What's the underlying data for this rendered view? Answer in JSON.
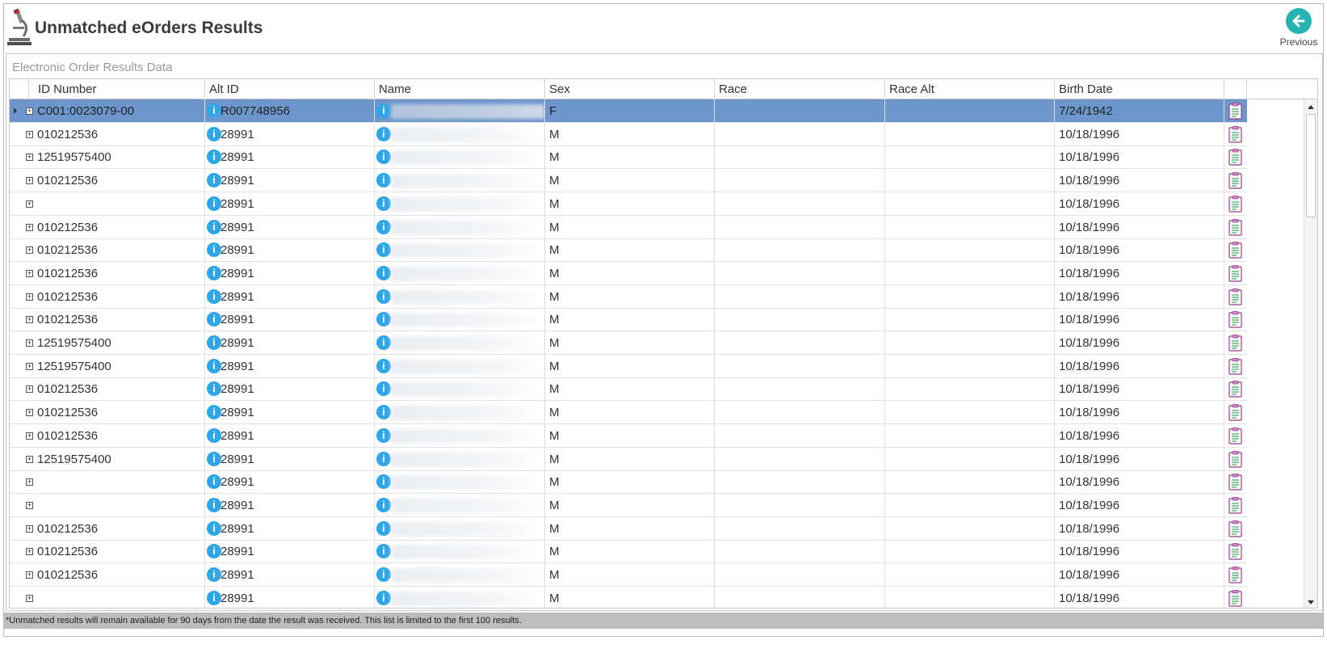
{
  "header": {
    "title": "Unmatched eOrders Results",
    "previous_label": "Previous"
  },
  "section": {
    "title": "Electronic Order Results Data"
  },
  "grid": {
    "columns": [
      "ID Number",
      "Alt ID",
      "Name",
      "Sex",
      "Race",
      "Race Alt",
      "Birth Date"
    ],
    "rows": [
      {
        "id": "C001:0023079-00",
        "alt": "R007748956",
        "sex": "F",
        "race": "",
        "race_alt": "",
        "birth": "7/24/1942",
        "selected": true
      },
      {
        "id": "010212536",
        "alt": "28991",
        "sex": "M",
        "race": "",
        "race_alt": "",
        "birth": "10/18/1996"
      },
      {
        "id": "12519575400",
        "alt": "28991",
        "sex": "M",
        "race": "",
        "race_alt": "",
        "birth": "10/18/1996"
      },
      {
        "id": "010212536",
        "alt": "28991",
        "sex": "M",
        "race": "",
        "race_alt": "",
        "birth": "10/18/1996"
      },
      {
        "id": "",
        "alt": "28991",
        "sex": "M",
        "race": "",
        "race_alt": "",
        "birth": "10/18/1996"
      },
      {
        "id": "010212536",
        "alt": "28991",
        "sex": "M",
        "race": "",
        "race_alt": "",
        "birth": "10/18/1996"
      },
      {
        "id": "010212536",
        "alt": "28991",
        "sex": "M",
        "race": "",
        "race_alt": "",
        "birth": "10/18/1996"
      },
      {
        "id": "010212536",
        "alt": "28991",
        "sex": "M",
        "race": "",
        "race_alt": "",
        "birth": "10/18/1996"
      },
      {
        "id": "010212536",
        "alt": "28991",
        "sex": "M",
        "race": "",
        "race_alt": "",
        "birth": "10/18/1996"
      },
      {
        "id": "010212536",
        "alt": "28991",
        "sex": "M",
        "race": "",
        "race_alt": "",
        "birth": "10/18/1996"
      },
      {
        "id": "12519575400",
        "alt": "28991",
        "sex": "M",
        "race": "",
        "race_alt": "",
        "birth": "10/18/1996"
      },
      {
        "id": "12519575400",
        "alt": "28991",
        "sex": "M",
        "race": "",
        "race_alt": "",
        "birth": "10/18/1996"
      },
      {
        "id": "010212536",
        "alt": "28991",
        "sex": "M",
        "race": "",
        "race_alt": "",
        "birth": "10/18/1996"
      },
      {
        "id": "010212536",
        "alt": "28991",
        "sex": "M",
        "race": "",
        "race_alt": "",
        "birth": "10/18/1996"
      },
      {
        "id": "010212536",
        "alt": "28991",
        "sex": "M",
        "race": "",
        "race_alt": "",
        "birth": "10/18/1996"
      },
      {
        "id": "12519575400",
        "alt": "28991",
        "sex": "M",
        "race": "",
        "race_alt": "",
        "birth": "10/18/1996"
      },
      {
        "id": "",
        "alt": "28991",
        "sex": "M",
        "race": "",
        "race_alt": "",
        "birth": "10/18/1996"
      },
      {
        "id": "",
        "alt": "28991",
        "sex": "M",
        "race": "",
        "race_alt": "",
        "birth": "10/18/1996"
      },
      {
        "id": "010212536",
        "alt": "28991",
        "sex": "M",
        "race": "",
        "race_alt": "",
        "birth": "10/18/1996"
      },
      {
        "id": "010212536",
        "alt": "28991",
        "sex": "M",
        "race": "",
        "race_alt": "",
        "birth": "10/18/1996"
      },
      {
        "id": "010212536",
        "alt": "28991",
        "sex": "M",
        "race": "",
        "race_alt": "",
        "birth": "10/18/1996"
      },
      {
        "id": "",
        "alt": "28991",
        "sex": "M",
        "race": "",
        "race_alt": "",
        "birth": "10/18/1996"
      }
    ]
  },
  "footer": {
    "note": "*Unmatched results will remain available for 90 days from the date the result was received. This list is limited to the first 100 results."
  },
  "icons": {
    "app": "microscope-icon",
    "previous": "arrow-left-icon",
    "info": "info-icon",
    "row_action": "clipboard-icon",
    "expand": "plus-box-icon"
  },
  "colors": {
    "selected_row": "#6d97cc",
    "info_icon": "#2fa6e8",
    "previous_button": "#27b3b0",
    "footer_bar": "#bdbdbd"
  }
}
